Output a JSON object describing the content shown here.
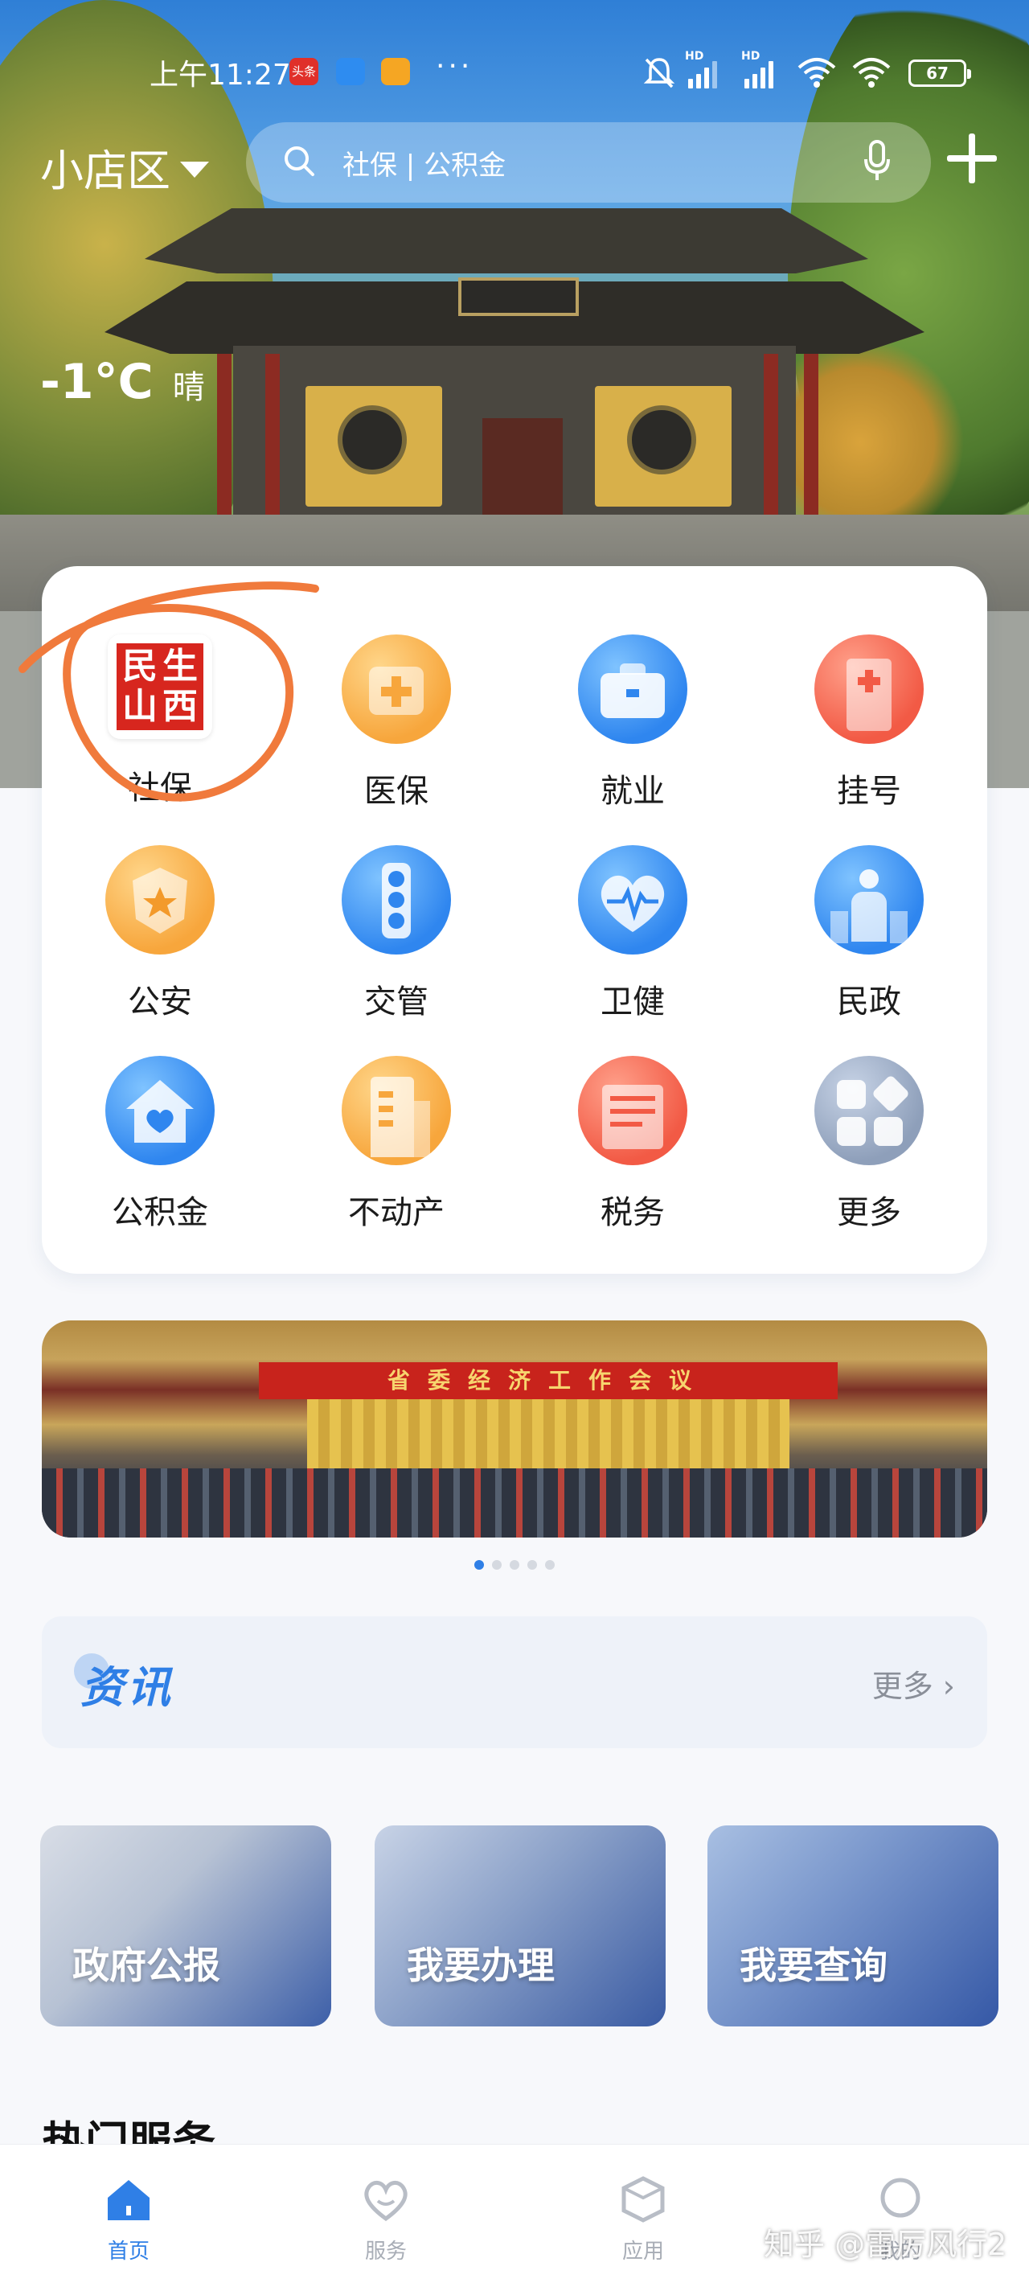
{
  "status_bar": {
    "time": "上午11:27",
    "badge_toutiao": "头条",
    "dots": "···",
    "hd1": "HD",
    "hd2": "HD",
    "battery": "67"
  },
  "header": {
    "district": "小店区",
    "search_placeholder": "社保 | 公积金"
  },
  "weather": {
    "temperature": "-1°C",
    "condition": "晴"
  },
  "services": [
    {
      "label": "社保",
      "icon": "shanxi-minsheng-seal-icon"
    },
    {
      "label": "医保",
      "icon": "medical-kit-icon"
    },
    {
      "label": "就业",
      "icon": "briefcase-icon"
    },
    {
      "label": "挂号",
      "icon": "hospital-building-icon"
    },
    {
      "label": "公安",
      "icon": "police-badge-icon"
    },
    {
      "label": "交管",
      "icon": "traffic-light-icon"
    },
    {
      "label": "卫健",
      "icon": "heartbeat-icon"
    },
    {
      "label": "民政",
      "icon": "person-civil-icon"
    },
    {
      "label": "公积金",
      "icon": "house-heart-icon"
    },
    {
      "label": "不动产",
      "icon": "building-icon"
    },
    {
      "label": "税务",
      "icon": "tax-icon"
    },
    {
      "label": "更多",
      "icon": "more-grid-icon"
    }
  ],
  "seal_text": [
    "民",
    "生",
    "山",
    "西"
  ],
  "banner": {
    "caption": "省委经济工作会议",
    "page_count": 5,
    "active_page": 1
  },
  "news": {
    "title": "资讯",
    "more": "更多"
  },
  "tiles": [
    "政府公报",
    "我要办理",
    "我要查询"
  ],
  "hot_section_title": "热门服务",
  "tabbar": [
    {
      "label": "首页",
      "icon": "home-icon",
      "active": true
    },
    {
      "label": "服务",
      "icon": "heart-icon",
      "active": false
    },
    {
      "label": "应用",
      "icon": "cube-icon",
      "active": false
    },
    {
      "label": "我的",
      "icon": "user-icon",
      "active": false
    }
  ],
  "watermark": "知乎 @雷厉风行2",
  "colors": {
    "accent": "#2f7fe6",
    "annotation": "#f07a3c"
  }
}
